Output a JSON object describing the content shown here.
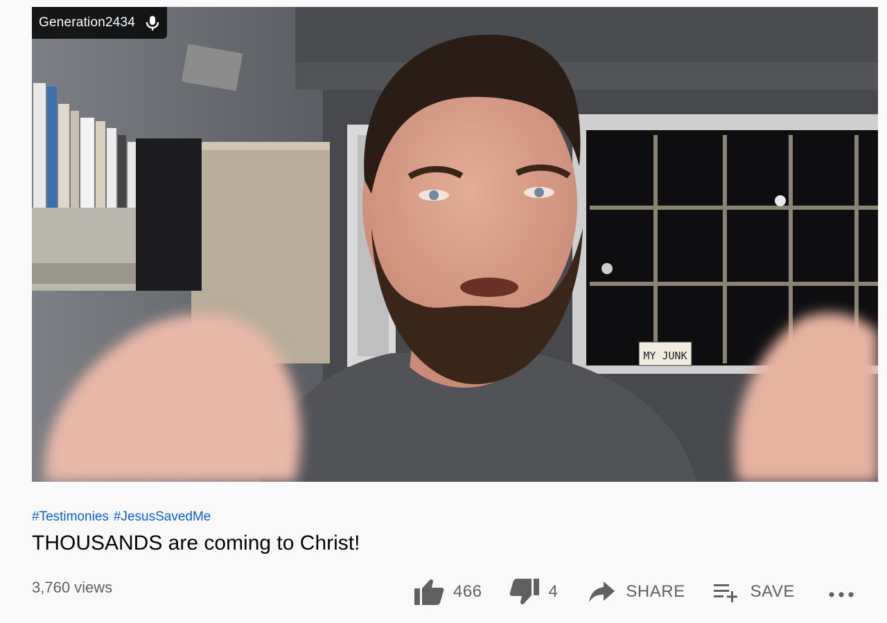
{
  "video": {
    "speaker_name": "Generation2434",
    "speaker_icon": "microphone-icon",
    "license_plate_text": "MY JUNK"
  },
  "hashtags": [
    "#Testimonies",
    "#JesusSavedMe"
  ],
  "title": "THOUSANDS are coming to Christ!",
  "views": "3,760 views",
  "actions": {
    "like_count": "466",
    "dislike_count": "4",
    "share_label": "SHARE",
    "save_label": "SAVE"
  },
  "colors": {
    "link": "#065fd4",
    "text_primary": "#030303",
    "text_secondary": "#606060",
    "background": "#f9f9f9"
  }
}
